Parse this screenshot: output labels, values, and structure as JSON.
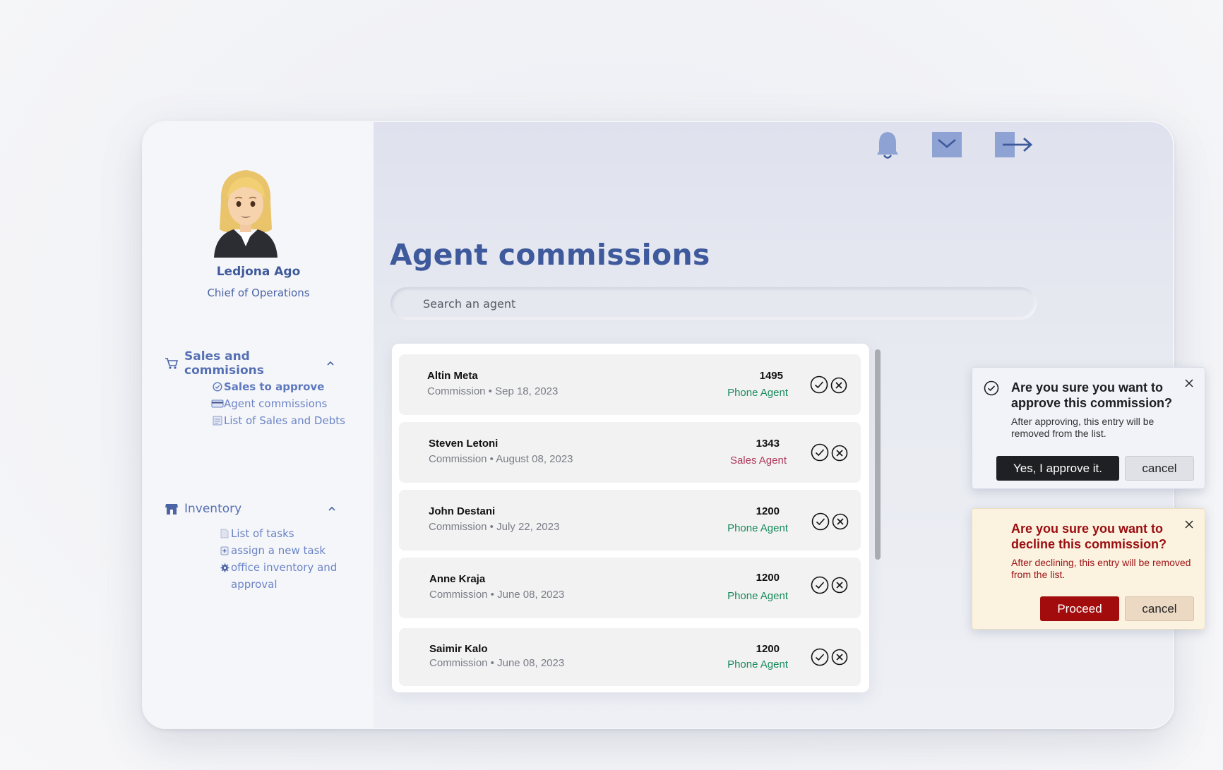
{
  "user": {
    "name": "Ledjona Ago",
    "role": "Chief of Operations"
  },
  "sidebar": {
    "sections": [
      {
        "label": "Sales and commisions",
        "icon": "cart-icon",
        "expanded": true,
        "items": [
          {
            "label": "Sales to approve",
            "icon": "check-circle-icon",
            "active": true
          },
          {
            "label": "Agent commissions",
            "icon": "credit-card-icon",
            "active": false
          },
          {
            "label": "List of Sales and Debts",
            "icon": "receipt-icon",
            "active": false
          }
        ]
      },
      {
        "label": "Inventory",
        "icon": "store-icon",
        "expanded": true,
        "items": [
          {
            "label": "List of tasks",
            "icon": "document-icon"
          },
          {
            "label": "assign a new task",
            "icon": "task-icon"
          },
          {
            "label": "office inventory and approval",
            "icon": "gear-icon"
          }
        ]
      }
    ]
  },
  "header": {
    "icons": [
      "bell-icon",
      "mail-icon",
      "logout-icon"
    ]
  },
  "main": {
    "title": "Agent commissions",
    "search_placeholder": "Search an agent",
    "rows": [
      {
        "name": "Altin Meta",
        "sub": "Commission • Sep 18, 2023",
        "amount": "1495",
        "role": "Phone Agent",
        "role_type": "phone"
      },
      {
        "name": "Steven Letoni",
        "sub": "Commission • August 08, 2023",
        "amount": "1343",
        "role": "Sales Agent",
        "role_type": "sales"
      },
      {
        "name": "John Destani",
        "sub": "Commission • July 22, 2023",
        "amount": "1200",
        "role": "Phone Agent",
        "role_type": "phone"
      },
      {
        "name": "Anne Kraja",
        "sub": "Commission • June 08, 2023",
        "amount": "1200",
        "role": "Phone Agent",
        "role_type": "phone"
      },
      {
        "name": "Saimir Kalo",
        "sub": "Commission • June 08, 2023",
        "amount": "1200",
        "role": "Phone Agent",
        "role_type": "phone"
      }
    ]
  },
  "dialogs": {
    "approve": {
      "title": "Are you sure you want to approve this commission?",
      "body": "After approving, this entry will be removed from the list.",
      "confirm": "Yes, I approve it.",
      "cancel": "cancel"
    },
    "decline": {
      "title": "Are you sure you want to decline this commission?",
      "body": "After declining, this entry will be removed from the list.",
      "confirm": "Proceed",
      "cancel": "cancel"
    }
  },
  "colors": {
    "brand": "#3f5a9c",
    "phone_agent": "#1a8a5c",
    "sales_agent": "#b03a5d",
    "danger": "#a30c0c"
  }
}
